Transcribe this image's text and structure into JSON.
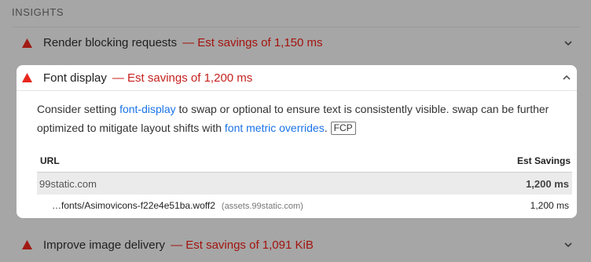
{
  "section": {
    "title": "INSIGHTS"
  },
  "audits": {
    "render_blocking": {
      "title": "Render blocking requests",
      "savings": "— Est savings of 1,150 ms"
    },
    "font_display": {
      "title": "Font display",
      "savings": "— Est savings of 1,200 ms",
      "description": {
        "part1": "Consider setting ",
        "link1": "font-display",
        "part2": " to swap or optional to ensure text is consistently visible. swap can be further optimized to mitigate layout shifts with ",
        "link2": "font metric overrides",
        "part3": ".",
        "badge": "FCP"
      },
      "table": {
        "headers": {
          "url": "URL",
          "savings": "Est Savings"
        },
        "group": {
          "label": "99static.com",
          "savings": "1,200 ms"
        },
        "rows": [
          {
            "url": "…fonts/Asimovicons-f22e4e51ba.woff2",
            "origin": "(assets.99static.com)",
            "savings": "1,200 ms"
          }
        ]
      }
    },
    "image_delivery": {
      "title": "Improve image delivery",
      "savings": "— Est savings of 1,091 KiB"
    }
  },
  "icons": {
    "warning": "warning-triangle-icon",
    "chevron_down": "chevron-down-icon",
    "chevron_up": "chevron-up-icon"
  },
  "colors": {
    "warning_red": "#e8261c",
    "savings_red": "#c5221f",
    "link_blue": "#1a73e8"
  }
}
